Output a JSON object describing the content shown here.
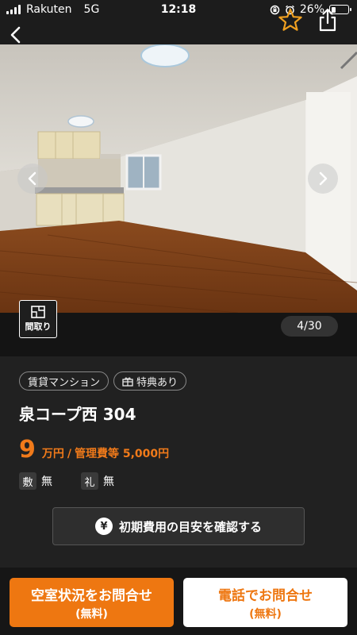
{
  "status_bar": {
    "carrier": "Rakuten",
    "network": "5G",
    "time": "12:18",
    "battery_text": "26%",
    "battery_level": 0.26
  },
  "nav": {
    "icons": [
      "back-icon",
      "star-icon",
      "share-icon"
    ],
    "accent_color": "#f0a020"
  },
  "gallery": {
    "counter": "4/30",
    "floorplan_label": "間取り"
  },
  "property": {
    "tags": [
      "賃貸マンション",
      "特典あり"
    ],
    "title": "泉コープ西 304",
    "rent_value": "9",
    "rent_unit": "万円",
    "separator": "/",
    "management_fee": "管理費等 5,000円",
    "deposit_label": "敷",
    "deposit_value": "無",
    "key_money_label": "礼",
    "key_money_value": "無",
    "cost_button": "初期費用の目安を確認する",
    "price_color": "#f07a1a"
  },
  "actions": {
    "vacancy_label": "空室状況をお問合せ",
    "vacancy_sub": "(無料)",
    "phone_label": "電話でお問合せ",
    "phone_sub": "(無料)",
    "primary_color": "#ee7711"
  }
}
